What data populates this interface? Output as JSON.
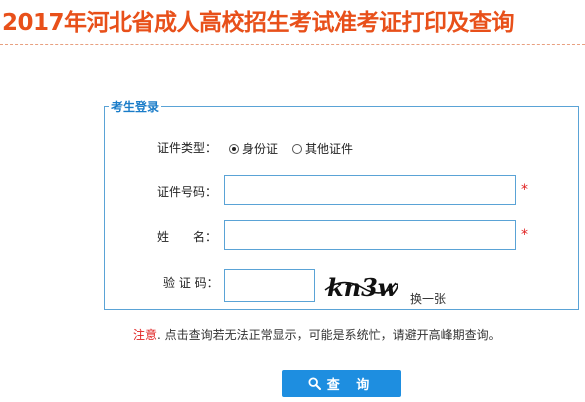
{
  "header": {
    "title": "2017年河北省成人高校招生考试准考证打印及查询"
  },
  "form": {
    "legend": "考生登录",
    "id_type": {
      "label": "证件类型：",
      "options": [
        "身份证",
        "其他证件"
      ],
      "selected": "身份证"
    },
    "id_number": {
      "label": "证件号码：",
      "value": "",
      "required_mark": "*"
    },
    "name": {
      "label": "姓　　名：",
      "value": "",
      "required_mark": "*"
    },
    "captcha": {
      "label": "验 证 码：",
      "value": "",
      "image_text": "kn3w",
      "refresh_label": "换一张"
    }
  },
  "notice": {
    "prefix": "注意",
    "text": ". 点击查询若无法正常显示，可能是系统忙，请避开高峰期查询。"
  },
  "submit": {
    "label": "查 询",
    "icon": "search-icon"
  },
  "colors": {
    "title": "#e8501a",
    "accent": "#1e8ee0",
    "border": "#5aa3d6",
    "required": "#e02020"
  }
}
